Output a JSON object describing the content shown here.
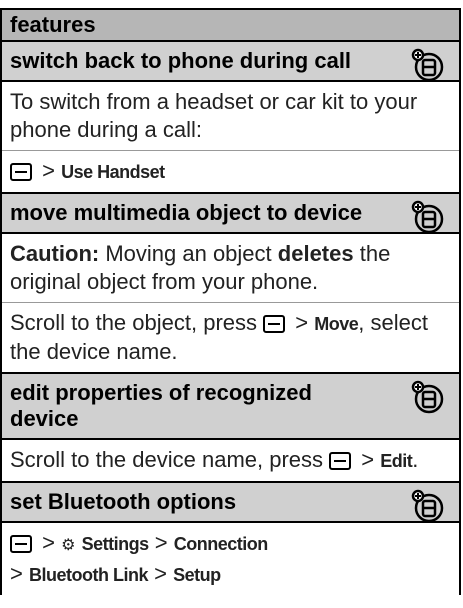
{
  "header": {
    "title": "features"
  },
  "sections": [
    {
      "title": "switch back to phone during call",
      "paragraphs": [
        "To switch from a headset or car kit to your phone during a call:"
      ],
      "path": {
        "items": [
          "Use Handset"
        ]
      }
    },
    {
      "title": "move multimedia object to device",
      "caution_label": "Caution:",
      "caution_text_1": "Moving an object",
      "caution_bold": "deletes",
      "caution_text_2": "the original object from your phone.",
      "instruction_pre": "Scroll to the object, press",
      "instruction_item": "Move",
      "instruction_post": ", select the device name."
    },
    {
      "title": "edit properties of recognized device",
      "instruction_pre": "Scroll to the device name, press",
      "instruction_item": "Edit",
      "instruction_post": "."
    },
    {
      "title": "set Bluetooth options",
      "path_line1": [
        "Settings",
        "Connection"
      ],
      "path_line2": [
        "Bluetooth Link",
        "Setup"
      ]
    }
  ],
  "icons": {
    "accessory": "headset-accessory-icon",
    "settings": "settings-icon",
    "menu_key": "menu-key-icon"
  }
}
